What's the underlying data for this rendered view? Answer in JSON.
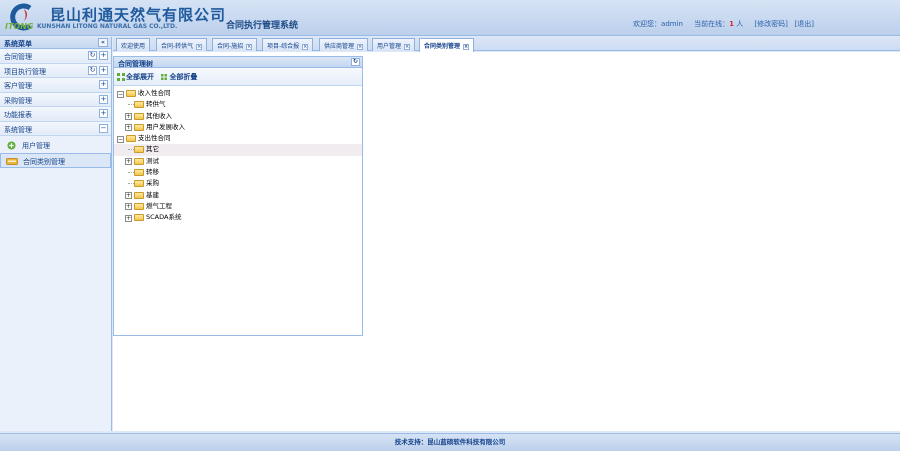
{
  "header": {
    "company_cn": "昆山利通天然气有限公司",
    "company_en": "KUNSHAN LITONG NATURAL GAS CO.,LTD.",
    "logo_itong": "ITONG",
    "system_title": "合同执行管理系统",
    "welcome_label": "欢迎您：",
    "username": "admin",
    "online_label": "当前在线：",
    "online_count": "1",
    "online_unit": "人",
    "change_password": "[修改密码]",
    "logout": "[退出]"
  },
  "sidebar": {
    "title": "系统菜单",
    "collapse_icon": "«",
    "menus": [
      {
        "label": "合同管理",
        "has_refresh": true,
        "toggle": "+"
      },
      {
        "label": "项目执行管理",
        "has_refresh": true,
        "toggle": "+"
      },
      {
        "label": "客户管理",
        "has_refresh": false,
        "toggle": "+"
      },
      {
        "label": "采购管理",
        "has_refresh": false,
        "toggle": "+"
      },
      {
        "label": "功能报表",
        "has_refresh": false,
        "toggle": "+"
      },
      {
        "label": "系统管理",
        "has_refresh": false,
        "toggle": "−"
      }
    ],
    "sub_items": [
      {
        "label": "用户管理",
        "icon": "user-add-icon",
        "selected": false
      },
      {
        "label": "合同类别管理",
        "icon": "category-icon",
        "selected": true
      }
    ]
  },
  "tabs": [
    {
      "label": "欢迎使用",
      "closable": false,
      "active": false
    },
    {
      "label": "合同-转供气",
      "closable": true,
      "active": false
    },
    {
      "label": "合同-施招",
      "closable": true,
      "active": false
    },
    {
      "label": "项目-综合报",
      "closable": true,
      "active": false
    },
    {
      "label": "供应商管理",
      "closable": true,
      "active": false
    },
    {
      "label": "用户管理",
      "closable": true,
      "active": false
    },
    {
      "label": "合同类别管理",
      "closable": true,
      "active": true
    }
  ],
  "panel": {
    "title": "合同管理树",
    "expand_all": "全部展开",
    "collapse_all": "全部折叠"
  },
  "tree": [
    {
      "label": "收入性合同",
      "level": 0,
      "expander": "−"
    },
    {
      "label": "转供气",
      "level": 1,
      "expander": ""
    },
    {
      "label": "其他收入",
      "level": 1,
      "expander": "+"
    },
    {
      "label": "用户发展收入",
      "level": 1,
      "expander": "+"
    },
    {
      "label": "支出性合同",
      "level": 0,
      "expander": "−"
    },
    {
      "label": "其它",
      "level": 1,
      "expander": "",
      "selected": true
    },
    {
      "label": "测试",
      "level": 1,
      "expander": "+"
    },
    {
      "label": "转移",
      "level": 1,
      "expander": ""
    },
    {
      "label": "采购",
      "level": 1,
      "expander": ""
    },
    {
      "label": "基建",
      "level": 1,
      "expander": "+"
    },
    {
      "label": "燃气工程",
      "level": 1,
      "expander": "+"
    },
    {
      "label": "SCADA系统",
      "level": 1,
      "expander": "+"
    }
  ],
  "footer": {
    "text": "技术支持：昆山蓝硕软件科技有限公司"
  },
  "colors": {
    "accent": "#15428b",
    "border": "#99bbe8",
    "background": "#dfe8f6",
    "online_count": "#d12a2a"
  }
}
